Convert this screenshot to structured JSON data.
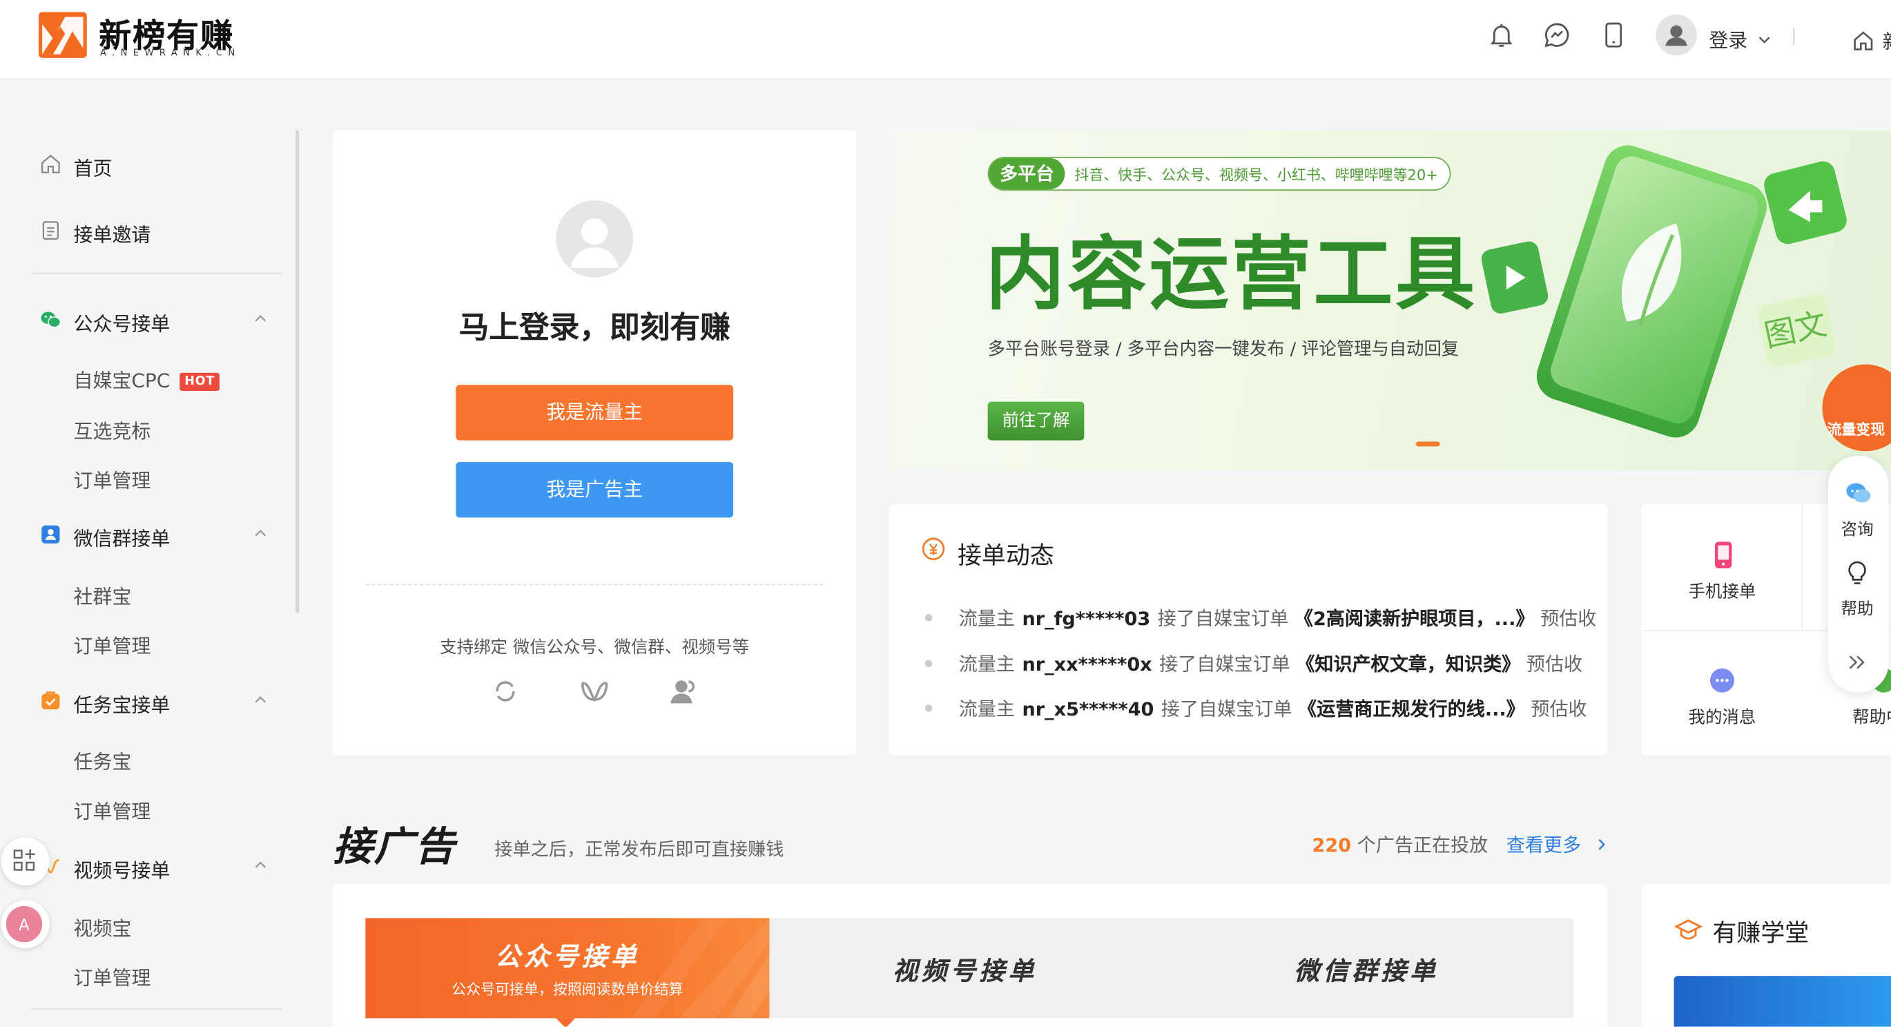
{
  "header": {
    "logo_text": "新榜有赚",
    "logo_subtext": "A.NEWRANK.CN",
    "login_label": "登录",
    "home_label": "新榜"
  },
  "sidebar": {
    "home": "首页",
    "invite": "接单邀请",
    "groups": [
      {
        "title": "公众号接单",
        "items": [
          "自媒宝CPC",
          "互选竞标",
          "订单管理"
        ],
        "hot_badge": "HOT"
      },
      {
        "title": "微信群接单",
        "items": [
          "社群宝",
          "订单管理"
        ]
      },
      {
        "title": "任务宝接单",
        "items": [
          "任务宝",
          "订单管理"
        ]
      },
      {
        "title": "视频号接单",
        "items": [
          "视频宝",
          "订单管理"
        ]
      }
    ]
  },
  "login_card": {
    "title": "马上登录，即刻有赚",
    "btn_traffic": "我是流量主",
    "btn_advertiser": "我是广告主",
    "support_text": "支持绑定 微信公众号、微信群、视频号等"
  },
  "banner": {
    "tag": "多平台",
    "platforms": "抖音、快手、公众号、视频号、小红书、哔哩哔哩等20+",
    "title": "内容运营工具",
    "subtitle": "多平台账号登录 / 多平台内容一键发布 / 评论管理与自动回复",
    "button": "前往了解",
    "tile_text": "图文",
    "corner_badge": "流量变现"
  },
  "feed": {
    "title": "接单动态",
    "rows": [
      {
        "role": "流量主",
        "user": "nr_fg*****03",
        "action": "接了自媒宝订单",
        "project": "《2高阅读新护眼项目，...》",
        "tail": "预估收"
      },
      {
        "role": "流量主",
        "user": "nr_xx*****0x",
        "action": "接了自媒宝订单",
        "project": "《知识产权文章，知识类》",
        "tail": "预估收"
      },
      {
        "role": "流量主",
        "user": "nr_x5*****40",
        "action": "接了自媒宝订单",
        "project": "《运营商正规发行的线...》",
        "tail": "预估收"
      }
    ]
  },
  "quick_tools": {
    "mobile": "手机接单",
    "messages": "我的消息",
    "help": "帮助中"
  },
  "side_float": {
    "consult": "咨询",
    "help": "帮助"
  },
  "ad_section": {
    "title": "接广告",
    "subtitle": "接单之后，正常发布后即可直接赚钱",
    "count": "220",
    "count_suffix": "个广告正在投放",
    "more": "查看更多",
    "tabs": [
      {
        "title": "公众号接单",
        "desc": "公众号可接单，按照阅读数单价结算"
      },
      {
        "title": "视频号接单"
      },
      {
        "title": "微信群接单"
      }
    ]
  },
  "school": {
    "title": "有赚学堂"
  },
  "colors": {
    "brand_orange": "#f26b21",
    "button_blue": "#3e97f2",
    "banner_green": "#2f8a2a",
    "link_blue": "#2f7ee0"
  }
}
